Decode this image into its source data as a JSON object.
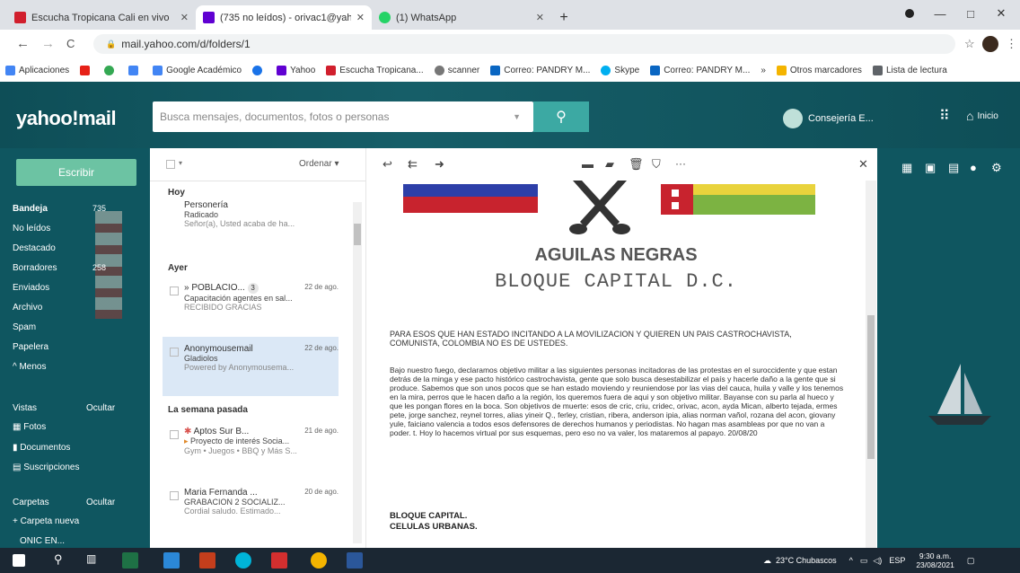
{
  "browser": {
    "tabs": [
      {
        "title": "Escucha Tropicana Cali en vivo",
        "fav_color": "#d11f2d"
      },
      {
        "title": "(735 no leídos) - orivac1@yaho...",
        "fav_color": "#6001d2"
      },
      {
        "title": "(1) WhatsApp",
        "fav_color": "#25d366"
      }
    ],
    "new_tab": "+",
    "window": {
      "minimize": "—",
      "maximize": "□",
      "close": "✕"
    },
    "nav": {
      "back": "←",
      "forward": "→",
      "reload": "C"
    },
    "url": "mail.yahoo.com/d/folders/1",
    "bookmarks": [
      {
        "label": "Aplicaciones",
        "color": "#4285f4"
      },
      {
        "label": "",
        "color": "#e62117"
      },
      {
        "label": "",
        "color": "#34a853"
      },
      {
        "label": "",
        "color": "#4285f4"
      },
      {
        "label": "Google Académico",
        "color": "#4285f4"
      },
      {
        "label": "",
        "color": "#1a73e8"
      },
      {
        "label": "Yahoo",
        "color": "#6001d2"
      },
      {
        "label": "Escucha Tropicana...",
        "color": "#d11f2d"
      },
      {
        "label": "scanner",
        "color": "#777777"
      },
      {
        "label": "Correo: PANDRY M...",
        "color": "#0a66c2"
      },
      {
        "label": "Skype",
        "color": "#00aff0"
      },
      {
        "label": "Correo: PANDRY M...",
        "color": "#0a66c2"
      },
      {
        "label": "»",
        "color": ""
      },
      {
        "label": "Otros marcadores",
        "color": "#f4b400"
      },
      {
        "label": "Lista de lectura",
        "color": "#5f6368"
      }
    ]
  },
  "yahoo": {
    "logo": "yahoo!mail",
    "search_placeholder": "Busca mensajes, documentos, fotos o personas",
    "user_name": "Consejería E...",
    "home_label": "Inicio",
    "compose": "Escribir",
    "folders": [
      {
        "label": "Bandeja",
        "count": "735",
        "bold": true
      },
      {
        "label": "No leídos",
        "count": ""
      },
      {
        "label": "Destacado",
        "count": ""
      },
      {
        "label": "Borradores",
        "count": "258"
      },
      {
        "label": "Enviados",
        "count": ""
      },
      {
        "label": "Archivo",
        "count": ""
      },
      {
        "label": "Spam",
        "count": ""
      },
      {
        "label": "Papelera",
        "count": ""
      },
      {
        "label": "^ Menos",
        "count": ""
      }
    ],
    "views_label": "Vistas",
    "views_hide": "Ocultar",
    "views": [
      "Fotos",
      "Documentos",
      "Suscripciones"
    ],
    "folders_label": "Carpetas",
    "folders_hide": "Ocultar",
    "new_folder": "+ Carpeta nueva",
    "custom_folder": "ONIC EN..."
  },
  "list": {
    "sort_label": "Ordenar",
    "groups": {
      "today": "Hoy",
      "yesterday": "Ayer",
      "last_week": "La semana pasada"
    },
    "messages": [
      {
        "sender": "Personería",
        "subject": "Radicado",
        "preview": "Señor(a), Usted acaba de ha...",
        "date": ""
      },
      {
        "sender": "» POBLACIO...",
        "badge": "3",
        "subject": "Capacitación agentes en sal...",
        "preview": "RECIBIDO GRACIAS",
        "date": "22 de ago."
      },
      {
        "sender": "Anonymousemail",
        "subject": "Gladiolos",
        "preview": "Powered by Anonymousema...",
        "date": "22 de ago."
      },
      {
        "sender": "Aptos Sur B...",
        "subject": "Proyecto de interés Socia...",
        "preview": "Gym • Juegos • BBQ y Más S...",
        "date": "21 de ago."
      },
      {
        "sender": "Maria Fernanda ...",
        "subject": "GRABACION 2 SOCIALIZ...",
        "preview": "Cordial saludo. Estimado...",
        "date": "20 de ago."
      }
    ]
  },
  "email": {
    "title_line1": "AGUILAS NEGRAS",
    "title_line2": "BLOQUE CAPITAL D.C.",
    "intro": "PARA ESOS QUE HAN ESTADO INCITANDO A LA MOVILIZACION Y QUIEREN UN PAIS CASTROCHAVISTA, COMUNISTA, COLOMBIA NO ES DE USTEDES.",
    "body": "Bajo nuestro fuego, declaramos objetivo militar a las siguientes personas incitadoras de las protestas en el suroccidente y que estan detrás de la minga y ese pacto histórico castrochavista, gente que solo busca desestabilizar el país y hacerle daño a la gente que si produce. Sabemos que son unos pocos que se han estado moviendo y reuniendose por las vias del cauca, huila y valle y los tenemos en la mira, perros que le hacen daño a la región, los queremos fuera de aqui y son objetivo militar. Bayanse con su parla al hueco y que les pongan flores en la boca. Son objetivos de muerte: esos de cric, criu, cridec, orivac, acon, ayda Mican, alberto tejada, ermes pete, jorge sanchez, reynel torres, alias yineir Q., ferley, cristian, ribera, anderson ipia, alias norman vañol, rozana del acon, giovany yule, faiciano valencia a todos esos defensores de derechos humanos y periodistas. No hagan mas asambleas por que no van a poder. t. Hoy lo hacemos virtual por sus esquemas, pero eso no va valer, los mataremos al papayo. 20/08/20",
    "sign_line1": "BLOQUE CAPITAL.",
    "sign_line2": "CELULAS URBANAS.",
    "close": "✕",
    "more": "···"
  },
  "taskbar": {
    "weather": "23°C Chubascos",
    "lang": "ESP",
    "time": "9:30 a.m.",
    "date": "23/08/2021"
  }
}
